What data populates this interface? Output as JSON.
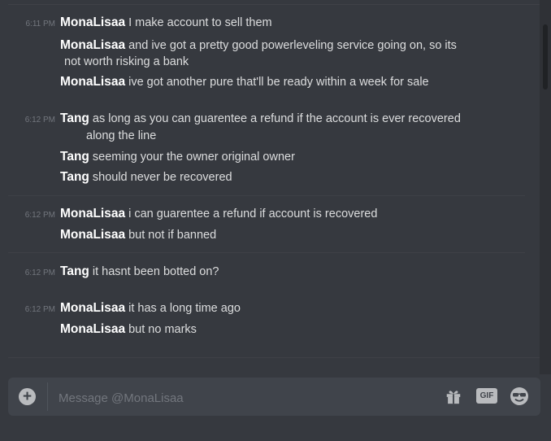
{
  "messages": [
    {
      "timestamp": "6:11 PM",
      "lines": [
        {
          "author": "MonaLisaa",
          "text": "I make account to sell them"
        },
        {
          "author": "MonaLisaa",
          "text": "and ive got a pretty good powerleveling service going on, so its"
        },
        {
          "author": "",
          "text": "not worth risking a bank"
        },
        {
          "author": "MonaLisaa",
          "text": "ive got another pure that'll be ready within a week for sale"
        }
      ]
    },
    {
      "timestamp": "6:12 PM",
      "lines": [
        {
          "author": "Tang",
          "text": "as long as you can guarentee a refund if the account is ever recovered"
        },
        {
          "author": "",
          "text": "along the line"
        },
        {
          "author": "Tang",
          "text": "seeming your the owner original owner"
        },
        {
          "author": "Tang",
          "text": "should never be recovered"
        }
      ]
    },
    {
      "timestamp": "6:12 PM",
      "lines": [
        {
          "author": "MonaLisaa",
          "text": "i can guarentee a refund if account is recovered"
        },
        {
          "author": "MonaLisaa",
          "text": "but not if banned"
        }
      ]
    },
    {
      "timestamp": "6:12 PM",
      "lines": [
        {
          "author": "Tang",
          "text": "it hasnt been botted on?"
        }
      ]
    },
    {
      "timestamp": "6:12 PM",
      "lines": [
        {
          "author": "MonaLisaa",
          "text": "it has a long time ago"
        },
        {
          "author": "MonaLisaa",
          "text": "but no marks"
        }
      ]
    }
  ],
  "composer": {
    "placeholder": "Message @MonaLisaa",
    "attach_icon": "plus-circle-icon",
    "gift_icon": "gift-icon",
    "gif_label": "GIF",
    "emoji_icon": "sunglasses-emoji-icon"
  },
  "colors": {
    "background": "#36393f",
    "composer_bg": "#40444b",
    "author": "#ffffff",
    "text": "#dcddde",
    "timestamp": "#72767d"
  }
}
